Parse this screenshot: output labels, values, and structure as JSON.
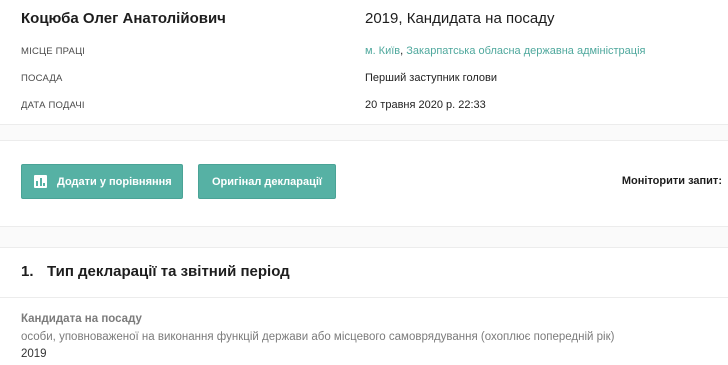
{
  "declarant": {
    "name": "Коцюба Олег Анатолійович",
    "declaration_title": "2019, Кандидата на посаду"
  },
  "info": {
    "workplace_label": "МІСЦЕ ПРАЦІ",
    "workplace_city": "м. Київ",
    "workplace_sep": ", ",
    "workplace_org": "Закарпатська обласна державна адміністрація",
    "position_label": "ПОСАДА",
    "position_value": "Перший заступник голови",
    "date_label": "ДАТА ПОДАЧІ",
    "date_value": "20 травня 2020 р. 22:33"
  },
  "actions": {
    "compare_label": "Додати у порівняння",
    "compare_icon": "bar-chart-icon",
    "original_label": "Оригінал декларації",
    "monitor_label": "Моніторити запит:"
  },
  "section": {
    "number": "1.",
    "title": "Тип декларації та звітний період",
    "type_name": "Кандидата на посаду",
    "type_desc": "особи, уповноваженої на виконання функцій держави або місцевого самоврядування (охоплює попередній рік)",
    "year": "2019"
  },
  "colors": {
    "accent": "#56b1a4",
    "link": "#4fa89d"
  }
}
